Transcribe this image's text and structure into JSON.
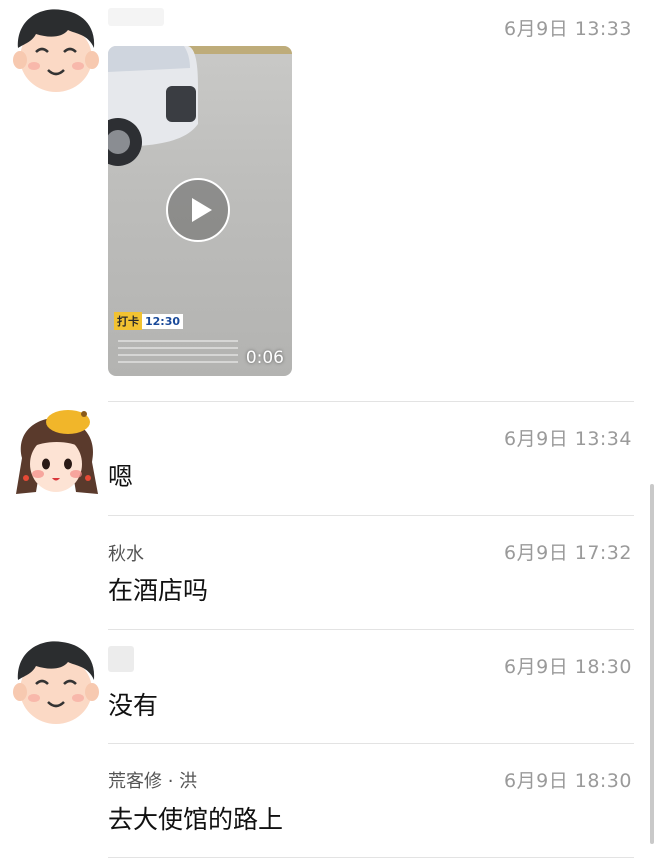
{
  "messages": [
    {
      "time": "6月9日 13:33",
      "video": {
        "duration": "0:06",
        "stamp_tag": "打卡",
        "stamp_time": "12:30"
      }
    },
    {
      "time": "6月9日 13:34",
      "text": "嗯"
    },
    {
      "name": "秋水",
      "time": "6月9日 17:32",
      "text": "在酒店吗"
    },
    {
      "time": "6月9日 18:30",
      "text": "没有"
    },
    {
      "name": "荒客修 · 洪",
      "time": "6月9日 18:30",
      "text": "去大使馆的路上"
    }
  ]
}
